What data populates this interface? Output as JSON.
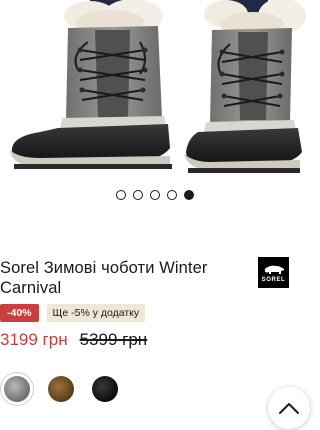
{
  "gallery": {
    "image_alt": "Sorel Winter Carnival boots",
    "slides_total": 5,
    "active_slide": 5
  },
  "product": {
    "title": "Sorel Зимові чоботи Winter Carnival",
    "brand": "SOREL",
    "discount_badge": "-40%",
    "promo_badge": "Ще -5% у додатку",
    "price_current": "3199 грн",
    "price_old": "5399 грн"
  },
  "colors": {
    "accent_red": "#c7403e",
    "promo_bg": "#efe6d5",
    "swatches": [
      {
        "name": "grey",
        "color": "#8a8c8a",
        "selected": true
      },
      {
        "name": "brown",
        "color": "#6b4a22",
        "selected": false
      },
      {
        "name": "black",
        "color": "#111111",
        "selected": false
      }
    ]
  },
  "icons": {
    "scroll_top": "chevron-up-icon",
    "brand": "polar-bear-icon"
  }
}
